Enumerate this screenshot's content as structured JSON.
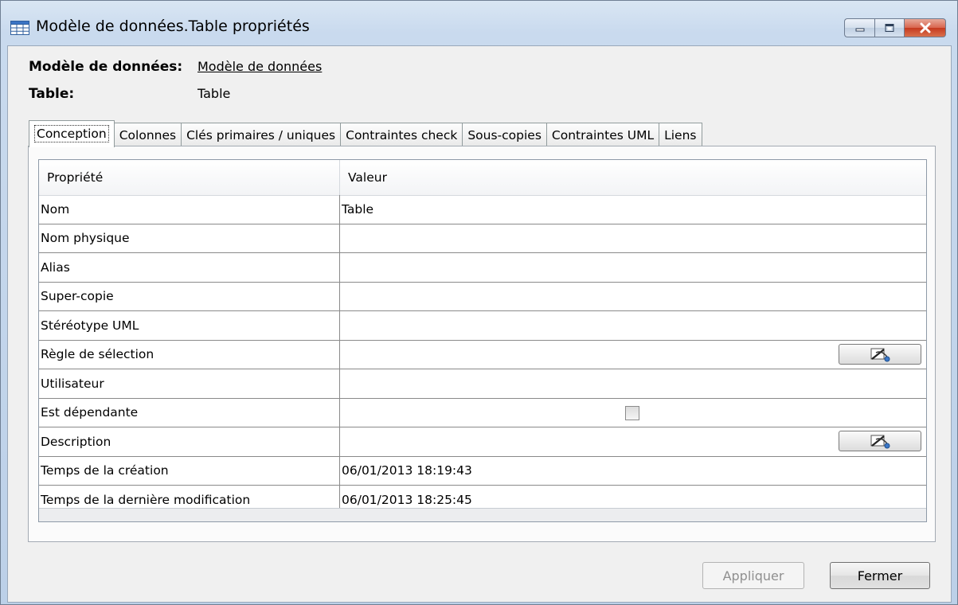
{
  "window": {
    "title": "Modèle de données.Table propriétés"
  },
  "header": {
    "model_label": "Modèle de données:",
    "model_value": "Modèle de données",
    "table_label": "Table:",
    "table_value": "Table"
  },
  "tabs": [
    {
      "label": "Conception",
      "active": true
    },
    {
      "label": "Colonnes"
    },
    {
      "label": "Clés primaires / uniques"
    },
    {
      "label": "Contraintes check"
    },
    {
      "label": "Sous-copies"
    },
    {
      "label": "Contraintes UML"
    },
    {
      "label": "Liens"
    }
  ],
  "grid": {
    "col_property": "Propriété",
    "col_value": "Valeur",
    "rows": [
      {
        "name": "Nom",
        "value": "Table"
      },
      {
        "name": "Nom physique",
        "value": ""
      },
      {
        "name": "Alias",
        "value": ""
      },
      {
        "name": "Super-copie",
        "value": ""
      },
      {
        "name": "Stéréotype UML",
        "value": ""
      },
      {
        "name": "Règle de sélection",
        "value": "",
        "editor": "edit-pencil-icon"
      },
      {
        "name": "Utilisateur",
        "value": ""
      },
      {
        "name": "Est dépendante",
        "value": "",
        "checkbox": false
      },
      {
        "name": "Description",
        "value": "",
        "editor": "edit-pencil-icon"
      },
      {
        "name": "Temps de la création",
        "value": "06/01/2013 18:19:43"
      },
      {
        "name": "Temps de la dernière modification",
        "value": "06/01/2013 18:25:45"
      }
    ]
  },
  "buttons": {
    "apply": "Appliquer",
    "close": "Fermer"
  },
  "colors": {
    "title_bg": "#c9daee",
    "close_btn": "#c5391f",
    "client_bg": "#f0f0f0",
    "grid_line": "#8a8a8a"
  }
}
